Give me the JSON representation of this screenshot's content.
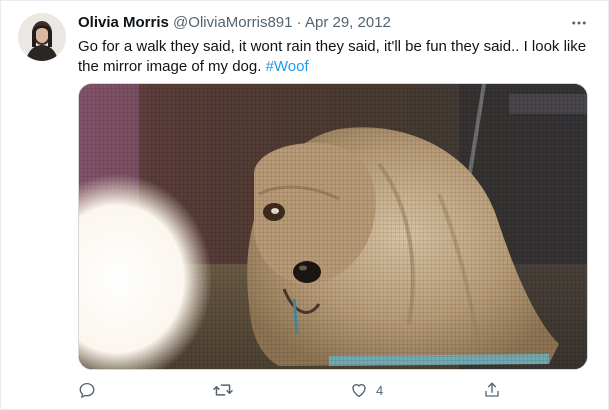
{
  "tweet": {
    "author_name": "Olivia Morris",
    "author_handle": "@OliviaMorris891",
    "separator": "·",
    "date": "Apr 29, 2012",
    "text": "Go for a walk they said, it wont rain they said, it'll be fun they said.. I look like the mirror image of my dog.",
    "hashtag": "#Woof"
  },
  "actions": {
    "reply_count": "",
    "retweet_count": "",
    "like_count": "4",
    "share_count": ""
  },
  "icons": {
    "more": "more-horizontal-icon",
    "reply": "reply-icon",
    "retweet": "retweet-icon",
    "like": "heart-icon",
    "share": "share-icon"
  },
  "colors": {
    "text": "#0f1419",
    "secondary": "#536471",
    "hashtag": "#1d9bf0"
  }
}
